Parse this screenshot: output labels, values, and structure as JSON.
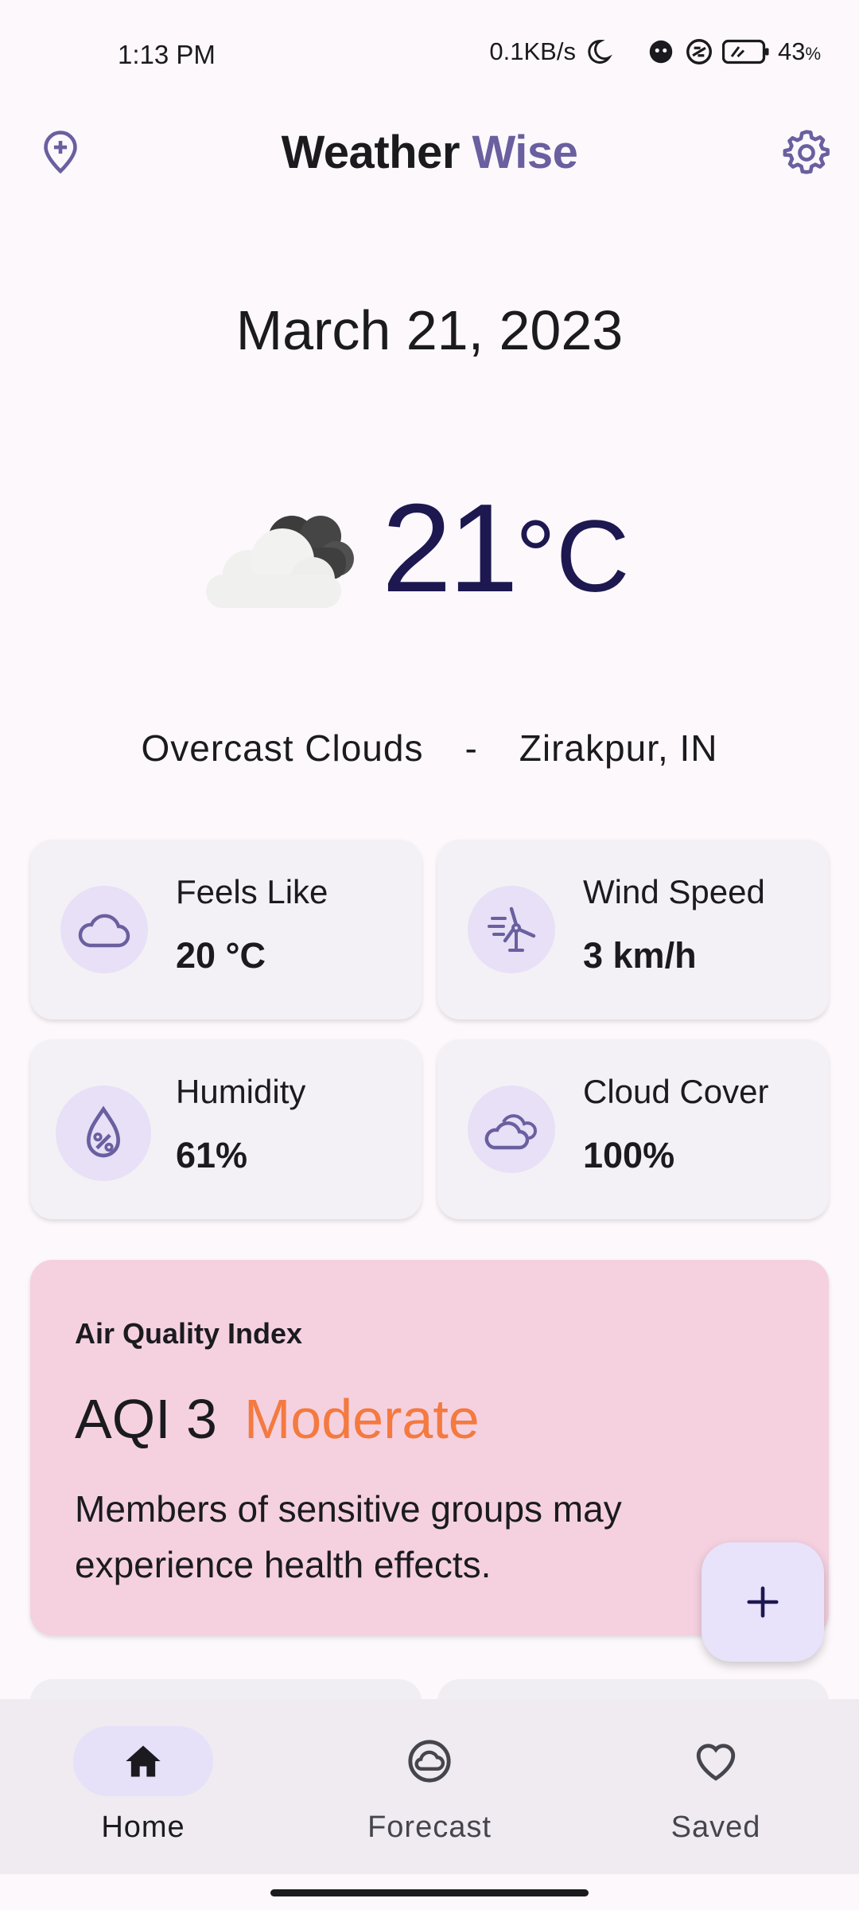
{
  "status_bar": {
    "time": "1:13 PM",
    "speed": "0.1KB/s",
    "battery": "43",
    "battery_unit": "%"
  },
  "app": {
    "title_part1": "Weather",
    "title_part2": "Wise"
  },
  "date": "March 21, 2023",
  "current": {
    "temperature": "21",
    "unit": "°C",
    "condition": "Overcast Clouds",
    "separator": "-",
    "location": "Zirakpur, IN",
    "icon": "overcast-cloud-icon"
  },
  "stats": [
    {
      "label": "Feels Like",
      "value": "20 °C",
      "icon": "cloud-icon"
    },
    {
      "label": "Wind Speed",
      "value": "3 km/h",
      "icon": "wind-turbine-icon"
    },
    {
      "label": "Humidity",
      "value": "61%",
      "icon": "humidity-drop-icon"
    },
    {
      "label": "Cloud Cover",
      "value": "100%",
      "icon": "clouds-icon"
    }
  ],
  "aqi": {
    "heading": "Air Quality Index",
    "value": "AQI 3",
    "level": "Moderate",
    "description": "Members of sensitive groups may experience health effects."
  },
  "nav": [
    {
      "label": "Home",
      "icon": "home-icon",
      "active": true
    },
    {
      "label": "Forecast",
      "icon": "forecast-icon",
      "active": false
    },
    {
      "label": "Saved",
      "icon": "heart-icon",
      "active": false
    }
  ],
  "colors": {
    "accent": "#6a5f9f",
    "temperature": "#1d1850",
    "aqi_background": "#f5d1e0",
    "aqi_level": "#f47a3f",
    "card_background": "#f4f1f6"
  }
}
